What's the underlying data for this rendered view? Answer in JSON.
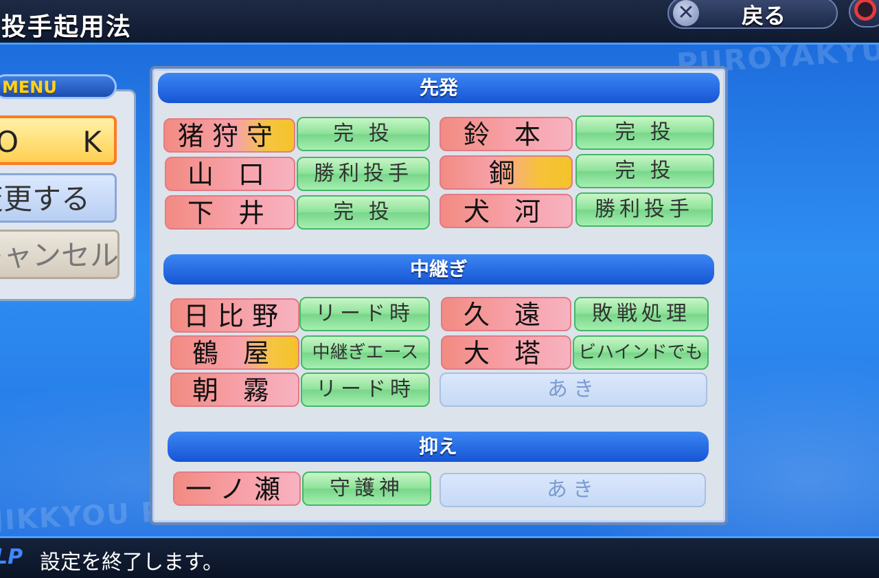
{
  "header": {
    "title": "投手起用法",
    "back_label": "戻る"
  },
  "watermarks": {
    "top": "PUROYAKYU",
    "bottom": "JIKKYOU PA"
  },
  "menu": {
    "title": "MENU",
    "ok_label": "O K",
    "change_label": "変更する",
    "cancel_label": "キャンセル"
  },
  "sections": {
    "starters": {
      "title": "先発",
      "rows": [
        {
          "left_name": "猪狩守",
          "left_role": "完 投",
          "right_name": "鈴 本",
          "right_role": "完 投"
        },
        {
          "left_name": "山 口",
          "left_role": "勝利投手",
          "right_name": "鋼",
          "right_role": "完 投"
        },
        {
          "left_name": "下 井",
          "left_role": "完 投",
          "right_name": "犬 河",
          "right_role": "勝利投手"
        }
      ]
    },
    "relievers": {
      "title": "中継ぎ",
      "rows": [
        {
          "left_name": "日比野",
          "left_role": "リード時",
          "right_name": "久 遠",
          "right_role": "敗戦処理"
        },
        {
          "left_name": "鶴 屋",
          "left_role": "中継ぎエース",
          "right_name": "大 塔",
          "right_role": "ビハインドでも"
        },
        {
          "left_name": "朝 霧",
          "left_role": "リード時",
          "right_empty": "あき"
        }
      ]
    },
    "closer": {
      "title": "抑え",
      "left_name": "一ノ瀬",
      "left_role": "守護神",
      "right_empty": "あき"
    }
  },
  "help": {
    "tag": "LP",
    "text": "設定を終了します。"
  }
}
